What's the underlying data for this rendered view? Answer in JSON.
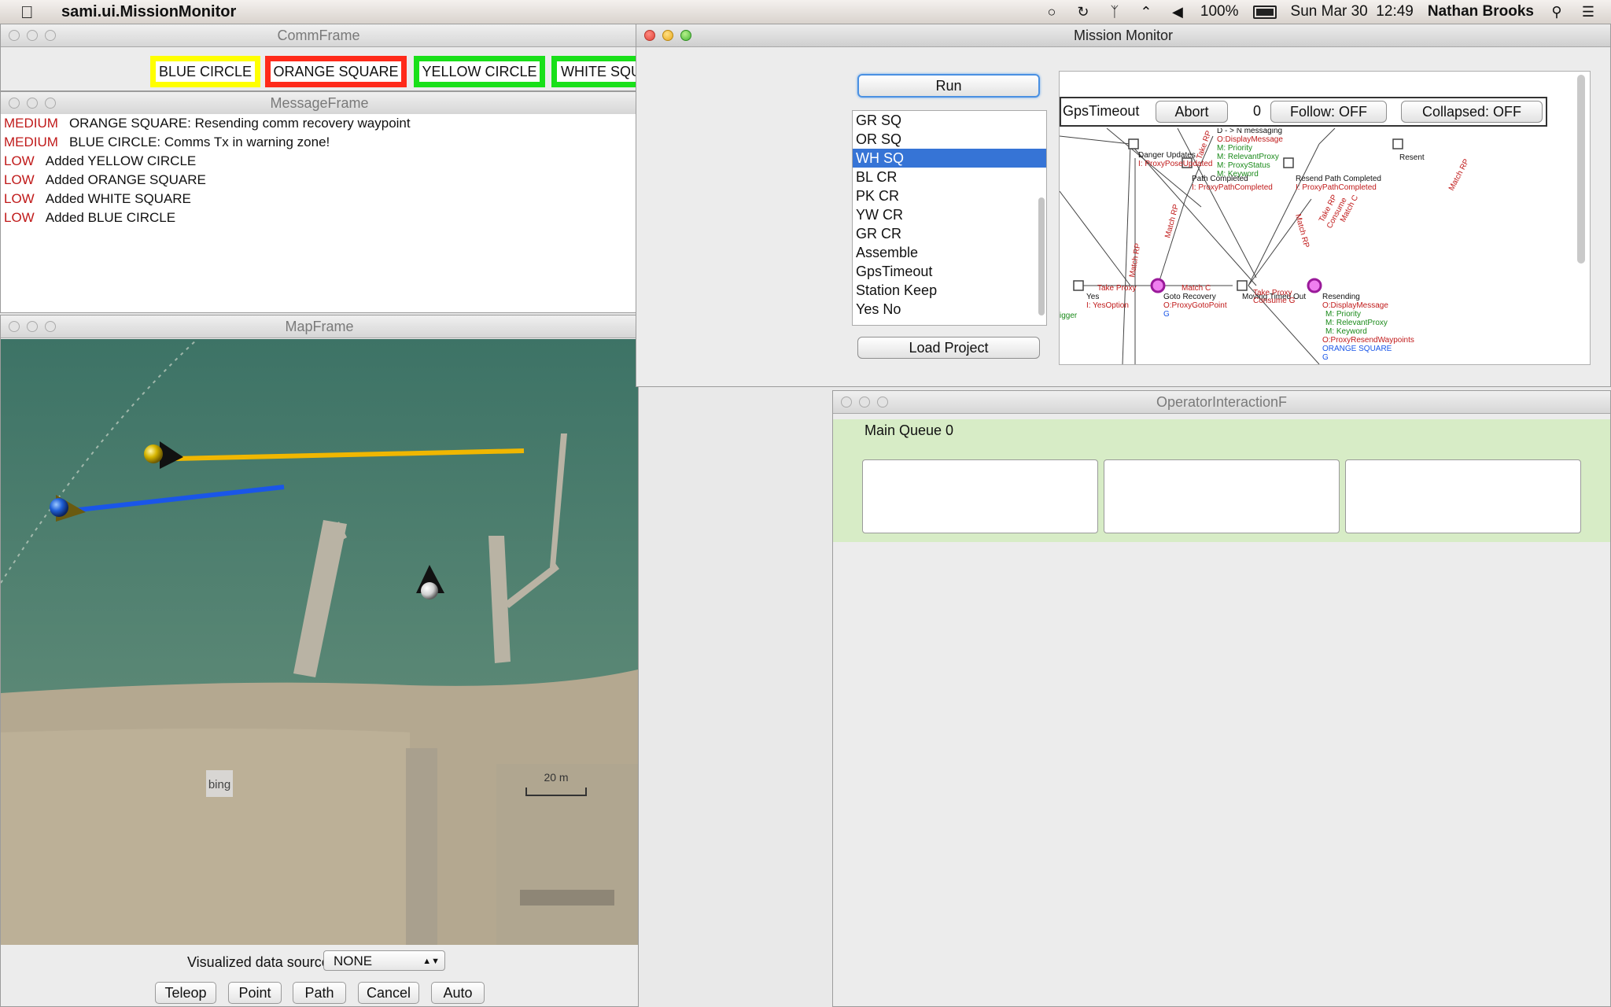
{
  "menubar": {
    "app_name": "sami.ui.MissionMonitor",
    "battery": "100%",
    "datetime": "Sun Mar 30  12:49",
    "user": "Nathan Brooks",
    "icons": [
      "apple-icon",
      "headphones-icon",
      "time-machine-icon",
      "bluetooth-icon",
      "wifi-icon",
      "volume-icon",
      "battery-icon",
      "search-icon",
      "list-icon"
    ]
  },
  "comm": {
    "title": "CommFrame",
    "boxes": [
      {
        "label": "BLUE CIRCLE",
        "color": "#ffff00"
      },
      {
        "label": "ORANGE SQUARE",
        "color": "#ff2a1a"
      },
      {
        "label": "YELLOW CIRCLE",
        "color": "#19e019"
      },
      {
        "label": "WHITE SQUARE",
        "color": "#19e019"
      }
    ]
  },
  "messages": {
    "title": "MessageFrame",
    "rows": [
      {
        "level": "MEDIUM",
        "text": "ORANGE SQUARE: Resending comm recovery waypoint"
      },
      {
        "level": "MEDIUM",
        "text": "BLUE CIRCLE: Comms Tx in warning zone!"
      },
      {
        "level": "LOW",
        "text": "Added YELLOW CIRCLE"
      },
      {
        "level": "LOW",
        "text": "Added ORANGE SQUARE"
      },
      {
        "level": "LOW",
        "text": "Added WHITE SQUARE"
      },
      {
        "level": "LOW",
        "text": "Added BLUE CIRCLE"
      }
    ]
  },
  "map": {
    "title": "MapFrame",
    "logo": "bing",
    "scale": "20 m",
    "data_source_label": "Visualized data source:",
    "data_source_value": "NONE",
    "buttons": [
      "Teleop",
      "Point",
      "Path",
      "Cancel",
      "Auto"
    ]
  },
  "mission": {
    "title": "Mission Monitor",
    "run_label": "Run",
    "load_label": "Load Project",
    "plays": [
      "GR SQ",
      "OR SQ",
      "WH SQ",
      "BL CR",
      "PK CR",
      "YW CR",
      "GR CR",
      "Assemble",
      "GpsTimeout",
      "Station Keep",
      "Yes No"
    ],
    "selected_play": "WH SQ",
    "graph": {
      "plan_name": "GpsTimeout",
      "abort_label": "Abort",
      "count": "0",
      "follow_label": "Follow: OFF",
      "collapsed_label": "Collapsed: OFF",
      "labels": {
        "d_n": "D - > N messaging",
        "o_display": "O:DisplayMessage",
        "m_priority": "M: Priority",
        "m_relevant": "M: RelevantProxy",
        "m_status": "M: ProxyStatus",
        "m_keyword": "M: Keyword",
        "danger": "Danger Updates",
        "i_pose": "I: ProxyPoseUpdated",
        "path_done": "Path Completed",
        "i_path": "I: ProxyPathCompleted",
        "resend_path": "Resend Path Completed",
        "i_path2": "I: ProxyPathCompleted",
        "resent": "Resent",
        "yes": "Yes",
        "i_yes": "I: YesOption",
        "trigger": "igger",
        "take_proxy": "Take Proxy",
        "match_c": "Match C",
        "goto": "Goto Recovery",
        "o_goto": "O:ProxyGotoPoint",
        "g1": "G",
        "moving": "Moving Timed Out",
        "take_proxy2": "Take Proxy",
        "consume": "Consume G",
        "resending": "Resending",
        "o_display2": "O:DisplayMessage",
        "m_priority2": "M: Priority",
        "m_relevant2": "M: RelevantProxy",
        "m_keyword2": "M: Keyword",
        "o_resend": "O:ProxyResendWaypoints",
        "orange": "ORANGE SQUARE",
        "g2": "G",
        "match_rp": "Match RP",
        "match_rp2": "Match RP",
        "take_rp": "Take RP",
        "match_rp3": "Match RP",
        "take_rp2": "Take RP",
        "consume2": "Consume",
        "match_c2": "Match C",
        "match_rp4": "Match RP"
      }
    }
  },
  "operator": {
    "title": "OperatorInteractionF",
    "queue_label": "Main Queue 0"
  }
}
